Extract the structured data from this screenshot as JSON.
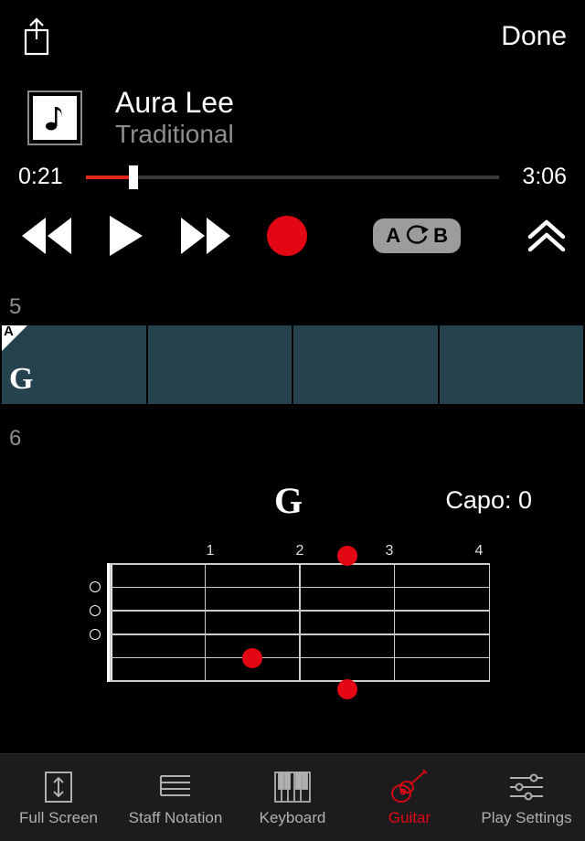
{
  "header": {
    "done": "Done"
  },
  "song": {
    "title": "Aura Lee",
    "artist": "Traditional"
  },
  "playback": {
    "current": "0:21",
    "total": "3:06",
    "progress_pct": 11.5
  },
  "ab": {
    "a": "A",
    "b": "B"
  },
  "bars": {
    "row1_num": "5",
    "row2_num": "6",
    "section_label": "A",
    "chord_label": "G"
  },
  "chord_panel": {
    "chord_name": "G",
    "capo_label": "Capo: 0",
    "frets": [
      "1",
      "2",
      "3",
      "4"
    ]
  },
  "tabs": {
    "fullscreen": "Full Screen",
    "staff": "Staff Notation",
    "keyboard": "Keyboard",
    "guitar": "Guitar",
    "settings": "Play Settings"
  },
  "colors": {
    "accent": "#e30613",
    "bar_bg": "#27424f"
  }
}
